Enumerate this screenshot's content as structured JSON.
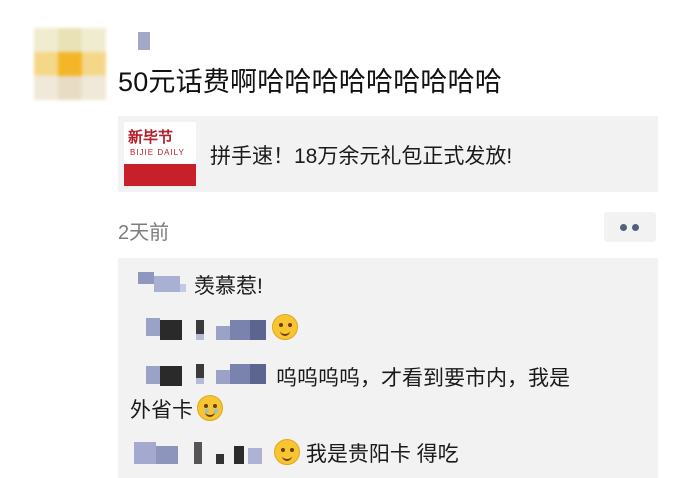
{
  "post": {
    "text": "50元话费啊哈哈哈哈哈哈哈哈哈",
    "link_card": {
      "thumbnail_title": "新毕节",
      "thumbnail_subtitle": "BIJIE DAILY",
      "text": "拼手速！18万余元礼包正式发放!"
    },
    "time": "2天前"
  },
  "comments": [
    {
      "text": "羡慕惹!"
    },
    {
      "emoji": "smile-emoji"
    },
    {
      "text_line1": "呜呜呜呜，才看到要市内，我是",
      "text_line2": "外省卡",
      "emoji": "crying-emoji"
    },
    {
      "text": "我是贵阳卡 得吃",
      "emoji": "grin-emoji"
    }
  ],
  "colors": {
    "comment_bg": "#f2f2f2",
    "time": "#7d7d7d",
    "more_dots": "#53607a",
    "brand_red": "#c8202b"
  }
}
